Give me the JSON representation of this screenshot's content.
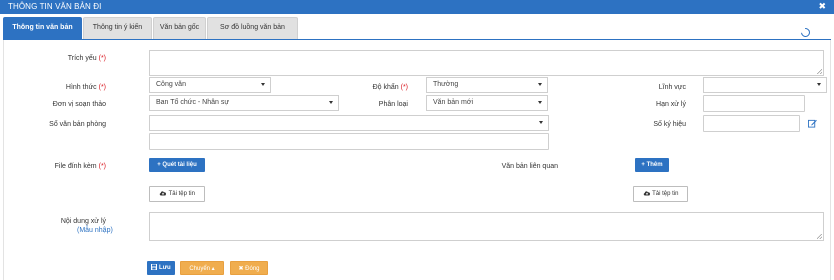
{
  "window": {
    "title": "THÔNG TIN VĂN BẢN ĐI",
    "close_glyph": "✖"
  },
  "tabs": [
    {
      "label": "Thông tin văn bản",
      "active": true
    },
    {
      "label": "Thông tin ý kiến",
      "active": false
    },
    {
      "label": "Văn bản gốc",
      "active": false
    },
    {
      "label": "Sơ đồ luồng văn bản",
      "active": false
    }
  ],
  "form": {
    "trich_yeu": {
      "label": "Trích yếu",
      "required": "(*)",
      "value": ""
    },
    "hinh_thuc": {
      "label": "Hình thức",
      "required": "(*)",
      "value": "Công văn"
    },
    "do_khan": {
      "label": "Độ khẩn",
      "required": "(*)",
      "value": "Thường"
    },
    "linh_vuc": {
      "label": "Lĩnh vực",
      "value": ""
    },
    "don_vi": {
      "label": "Đơn vị soạn thảo",
      "value": "Ban Tổ chức - Nhân sự"
    },
    "phan_loai": {
      "label": "Phân loại",
      "value": "Văn bản mới"
    },
    "han_xu_ly": {
      "label": "Hạn xử lý",
      "value": ""
    },
    "so_van_ban": {
      "label": "Sổ văn bản phòng",
      "value": ""
    },
    "so_ky_hieu": {
      "label": "Số ký hiệu",
      "value": ""
    },
    "file_dinh_kem": {
      "label": "File đính kèm",
      "required": "(*)",
      "scan_button": "Quét tài liệu",
      "upload_button": "Tải tệp tin"
    },
    "van_ban_lien_quan": {
      "label": "Văn bản liên quan",
      "add_button": "Thêm",
      "upload_button": "Tải tệp tin"
    },
    "noi_dung": {
      "label": "Nội dung xử lý",
      "template_link": "(Mẫu nhập)",
      "value": ""
    }
  },
  "footer": {
    "save": "Lưu",
    "transfer": "Chuyển",
    "close": "Đóng"
  },
  "colors": {
    "primary": "#2d72c2",
    "required": "#d9161e",
    "orange": "#f0ad4e",
    "tab_inactive": "#e1e1e1"
  }
}
